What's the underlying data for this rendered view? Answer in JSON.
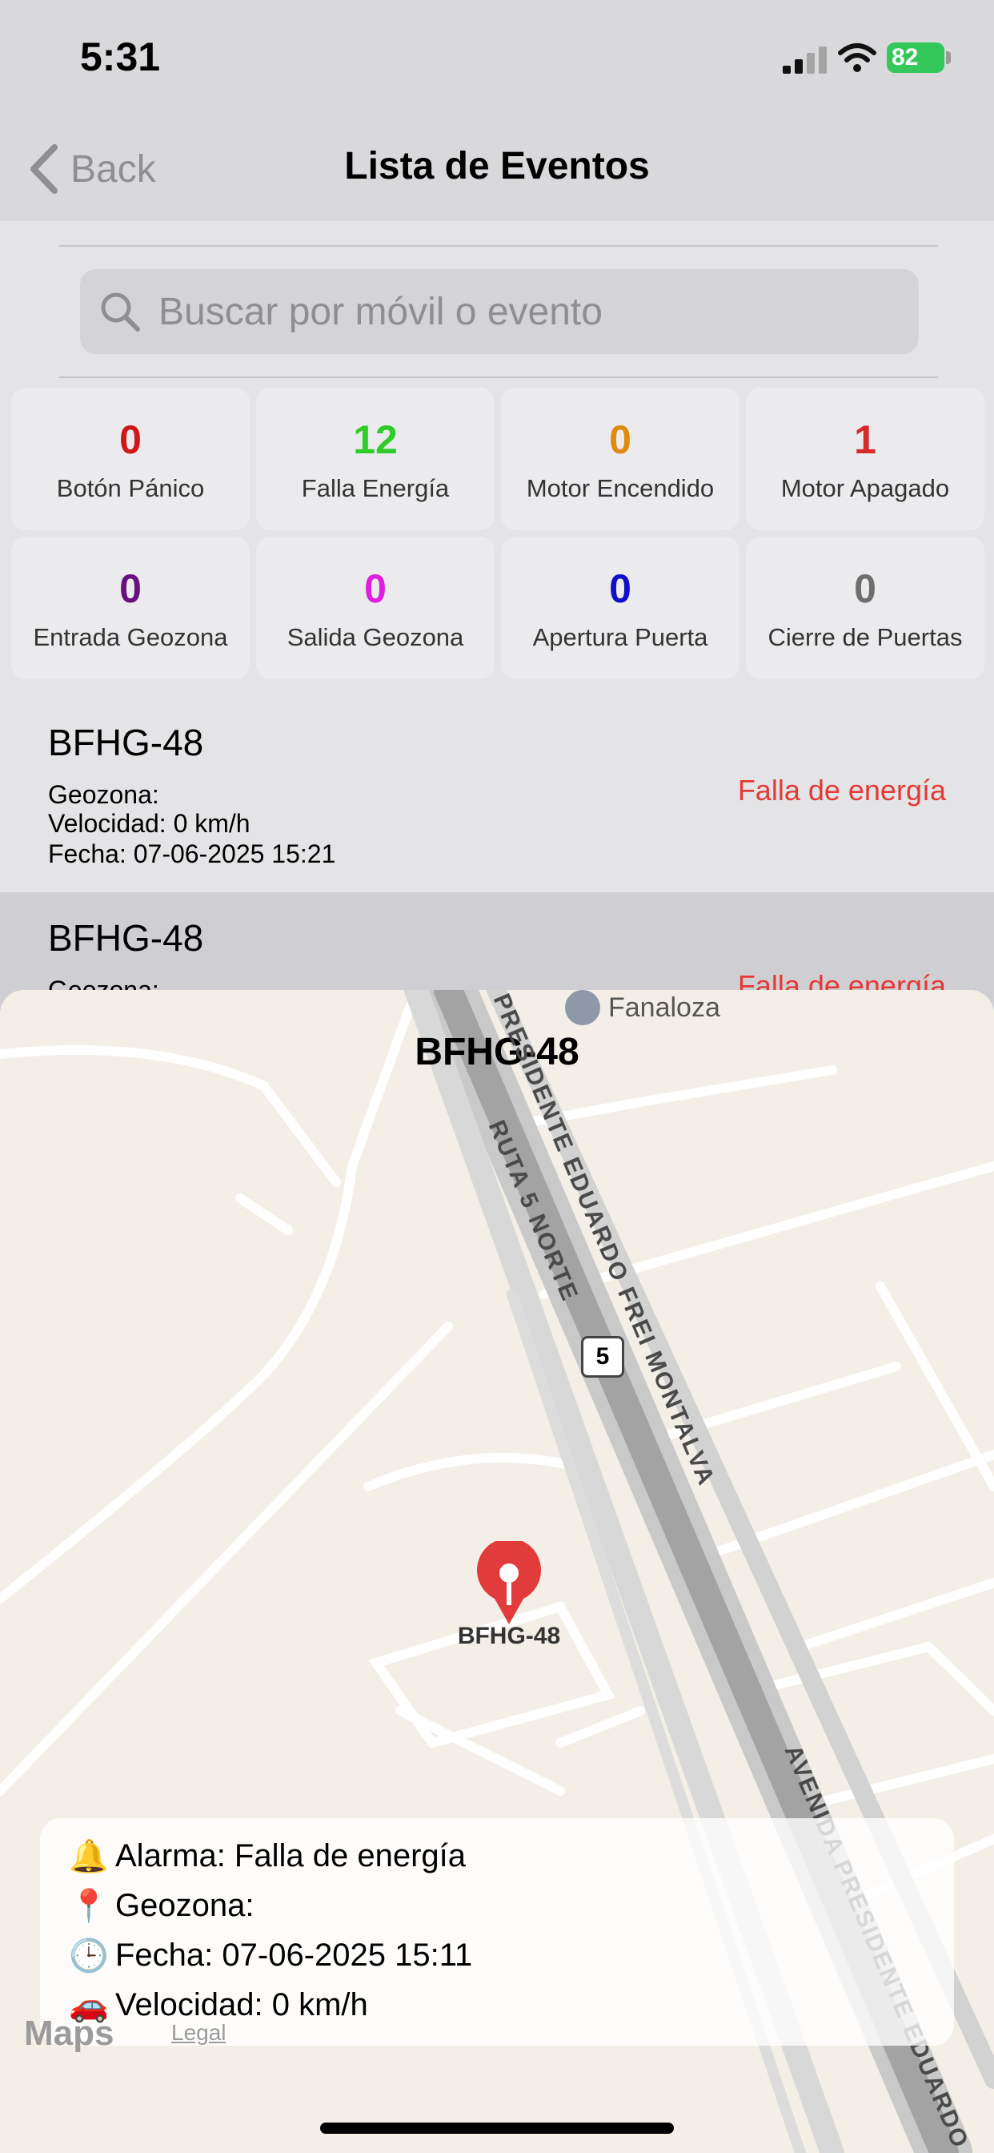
{
  "status": {
    "time": "5:31",
    "battery": "82"
  },
  "nav": {
    "back_label": "Back",
    "title": "Lista de Eventos"
  },
  "search": {
    "placeholder": "Buscar por móvil o evento"
  },
  "stats": [
    {
      "count": "0",
      "label": "Botón Pánico",
      "color": "#d01818"
    },
    {
      "count": "12",
      "label": "Falla Energía",
      "color": "#2ecc28"
    },
    {
      "count": "0",
      "label": "Motor Encendido",
      "color": "#e08a10"
    },
    {
      "count": "1",
      "label": "Motor Apagado",
      "color": "#d62b2b"
    },
    {
      "count": "0",
      "label": "Entrada Geozona",
      "color": "#6a0f80"
    },
    {
      "count": "0",
      "label": "Salida Geozona",
      "color": "#e01ee0"
    },
    {
      "count": "0",
      "label": "Apertura Puerta",
      "color": "#1010c8"
    },
    {
      "count": "0",
      "label": "Cierre de Puertas",
      "color": "#6e6e6e"
    }
  ],
  "events": [
    {
      "plate": "BFHG-48",
      "geozona": "Geozona:",
      "velocidad": "Velocidad: 0 km/h",
      "fecha": "Fecha: 07-06-2025 15:21",
      "type": "Falla de energía"
    },
    {
      "plate": "BFHG-48",
      "geozona": "Geozona:",
      "type": "Falla de energía"
    }
  ],
  "sheet": {
    "title": "BFHG-48",
    "poi": "Fanaloza",
    "pin_label": "BFHG-48",
    "route_shield": "5",
    "roads": {
      "frei": "PRESIDENTE EDUARDO FREI MONTALVA",
      "ruta5": "RUTA 5 NORTE",
      "avenida": "AVENIDA PRESIDENTE EDUARDO"
    },
    "maps_brand": "Maps",
    "legal": "Legal",
    "info": {
      "alarma": {
        "icon": "🔔",
        "text": "Alarma: Falla de energía"
      },
      "geozona": {
        "icon": "📍",
        "text": "Geozona:"
      },
      "fecha": {
        "icon": "🕒",
        "text": "Fecha: 07-06-2025 15:11"
      },
      "velocidad": {
        "icon": "🚗",
        "text": "Velocidad: 0 km/h"
      }
    }
  }
}
